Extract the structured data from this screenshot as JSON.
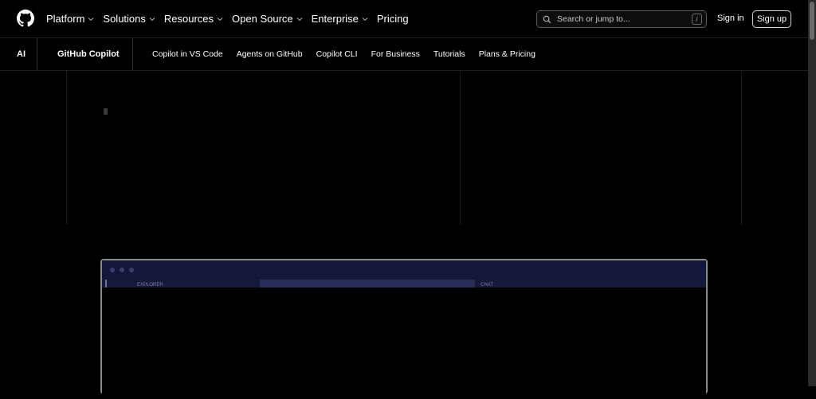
{
  "nav": {
    "items": [
      {
        "label": "Platform",
        "has_dropdown": true
      },
      {
        "label": "Solutions",
        "has_dropdown": true
      },
      {
        "label": "Resources",
        "has_dropdown": true
      },
      {
        "label": "Open Source",
        "has_dropdown": true
      },
      {
        "label": "Enterprise",
        "has_dropdown": true
      },
      {
        "label": "Pricing",
        "has_dropdown": false
      }
    ],
    "search_placeholder": "Search or jump to...",
    "search_shortcut": "/",
    "sign_in": "Sign in",
    "sign_up": "Sign up"
  },
  "subnav": {
    "section": "AI",
    "product": "GitHub Copilot",
    "links": [
      "Copilot in VS Code",
      "Agents on GitHub",
      "Copilot CLI",
      "For Business",
      "Tutorials",
      "Plans & Pricing"
    ]
  },
  "editor": {
    "explorer_label": "EXPLORER",
    "chat_label": "CHAT"
  },
  "colors": {
    "background": "#000000",
    "editor_titlebar": "#15173a",
    "editor_border": "#8a8a8a"
  }
}
